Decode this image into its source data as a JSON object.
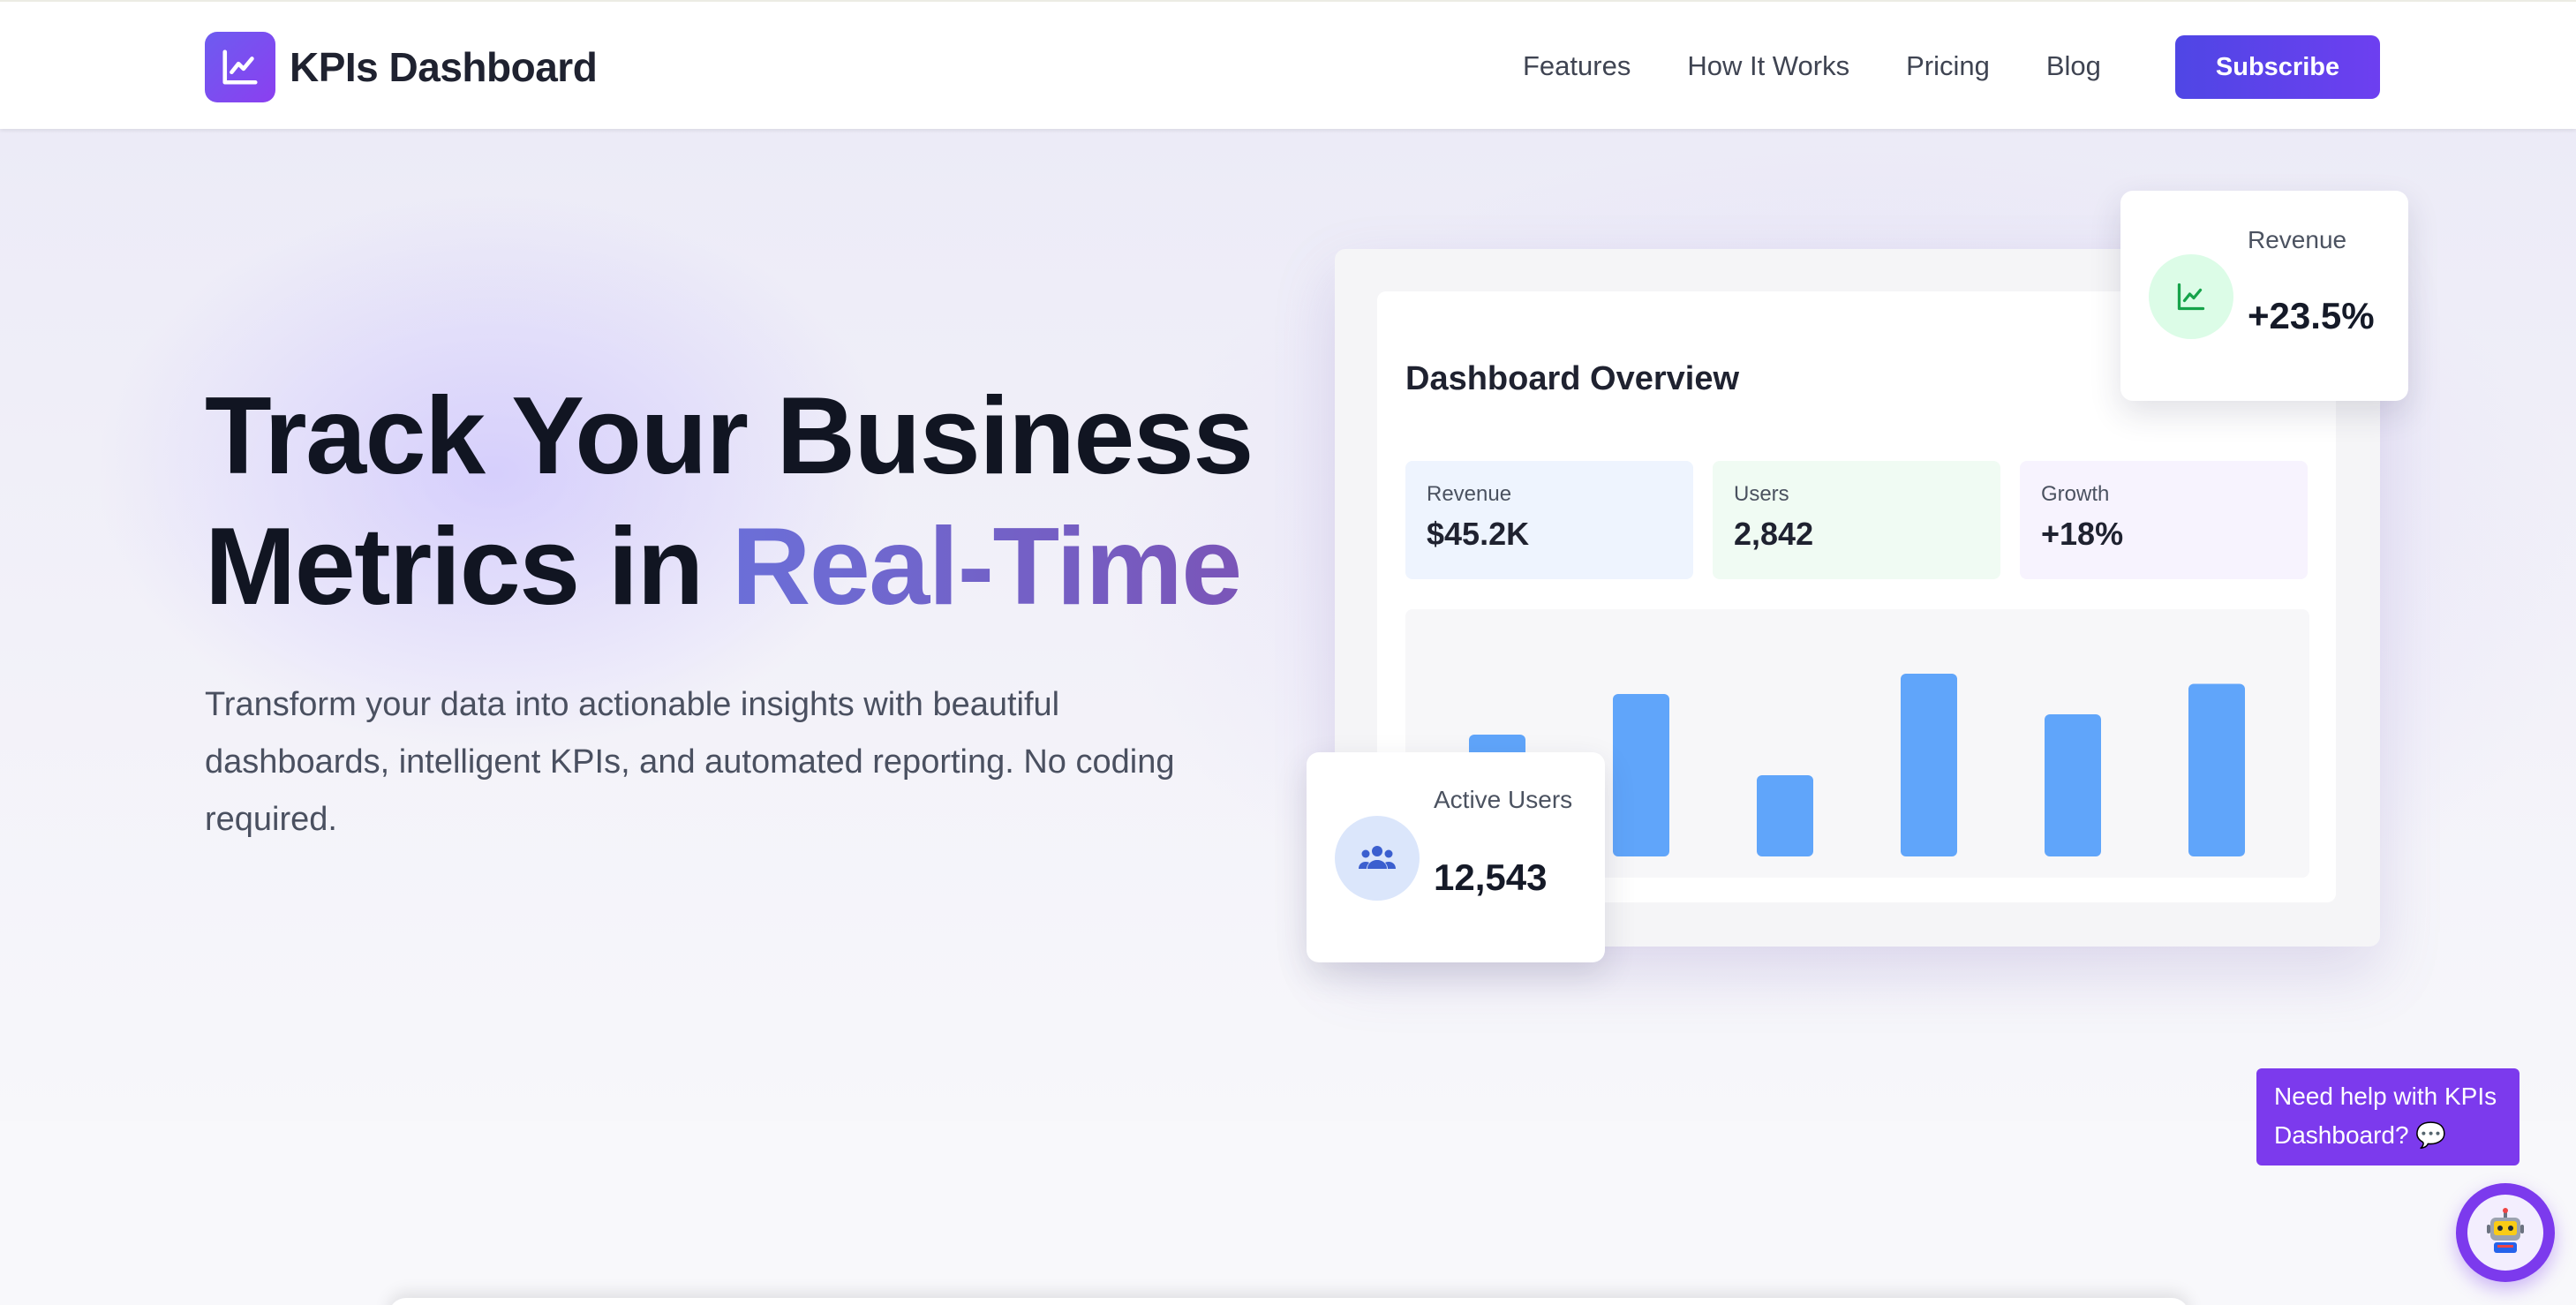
{
  "brand": {
    "name": "KPIs Dashboard",
    "logo_icon": "chart-line-icon",
    "accent": "#6d5cf0"
  },
  "nav": {
    "links": [
      "Features",
      "How It Works",
      "Pricing",
      "Blog"
    ],
    "subscribe_label": "Subscribe"
  },
  "hero": {
    "headline_line1": "Track Your Business",
    "headline_line2_prefix": "Metrics in ",
    "headline_accent": "Real-Time",
    "subcopy": "Transform your data into actionable insights with beautiful dashboards, intelligent KPIs, and automated reporting. No coding required."
  },
  "mock": {
    "title": "Dashboard Overview",
    "stats": [
      {
        "label": "Revenue",
        "value": "$45.2K"
      },
      {
        "label": "Users",
        "value": "2,842"
      },
      {
        "label": "Growth",
        "value": "+18%"
      }
    ],
    "bar_values": [
      0.6,
      0.8,
      0.4,
      0.9,
      0.7,
      0.85
    ],
    "bar_color": "#60a5fa"
  },
  "floating": {
    "revenue": {
      "label": "Revenue",
      "value": "+23.5%",
      "icon": "trending-up-icon"
    },
    "active_users": {
      "label": "Active Users",
      "value": "12,543",
      "icon": "users-icon"
    }
  },
  "help": {
    "text": "Need help with KPIs Dashboard? 💬",
    "fab_icon": "robot-avatar-icon",
    "color": "#7c3aed"
  }
}
